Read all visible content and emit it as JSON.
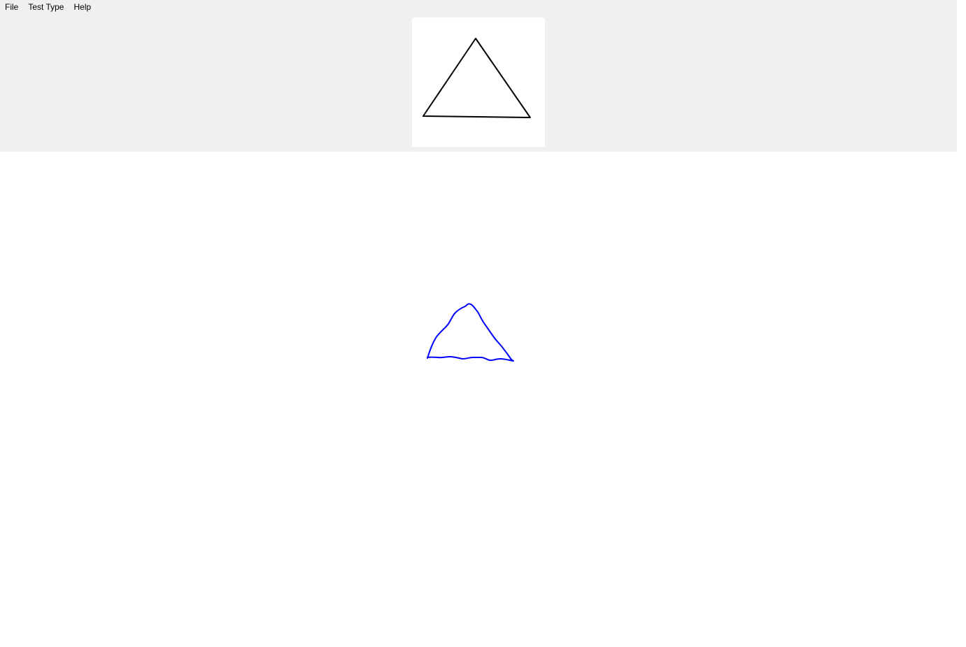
{
  "menu": {
    "file_label": "File",
    "test_type_label": "Test Type",
    "help_label": "Help"
  },
  "template": {
    "shape": "triangle",
    "stroke_color": "#000000"
  },
  "drawing": {
    "shape": "hand-drawn triangle",
    "stroke_color": "#0000ff"
  },
  "colors": {
    "panel_background": "#f0f0f0",
    "canvas_background": "#ffffff"
  }
}
